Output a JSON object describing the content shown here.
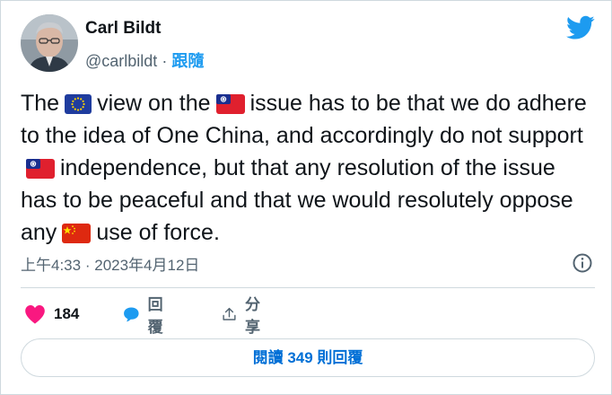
{
  "author": {
    "name": "Carl Bildt",
    "handle": "@carlbildt",
    "separator": "·",
    "follow_label": "跟隨"
  },
  "tweet": {
    "text_parts": [
      "The",
      "view on the",
      "issue has to be that we do adhere to the idea of One China, and accordingly do not support",
      "independence, but that any resolution of the issue has to be peaceful and that we would resolutely oppose any",
      "use of force."
    ],
    "flag_icons": [
      "eu-flag-icon",
      "taiwan-flag-icon",
      "taiwan-flag-icon",
      "china-flag-icon"
    ]
  },
  "meta": {
    "time": "上午4:33",
    "separator": "·",
    "date": "2023年4月12日"
  },
  "actions": {
    "likes": "184",
    "reply_label": "回覆",
    "share_label": "分享"
  },
  "read_replies": {
    "label": "閱讀 349 則回覆"
  },
  "colors": {
    "accent": "#1d9bf0",
    "like": "#f91880",
    "text": "#0f1419",
    "muted": "#536471",
    "border": "#cfd9de"
  }
}
